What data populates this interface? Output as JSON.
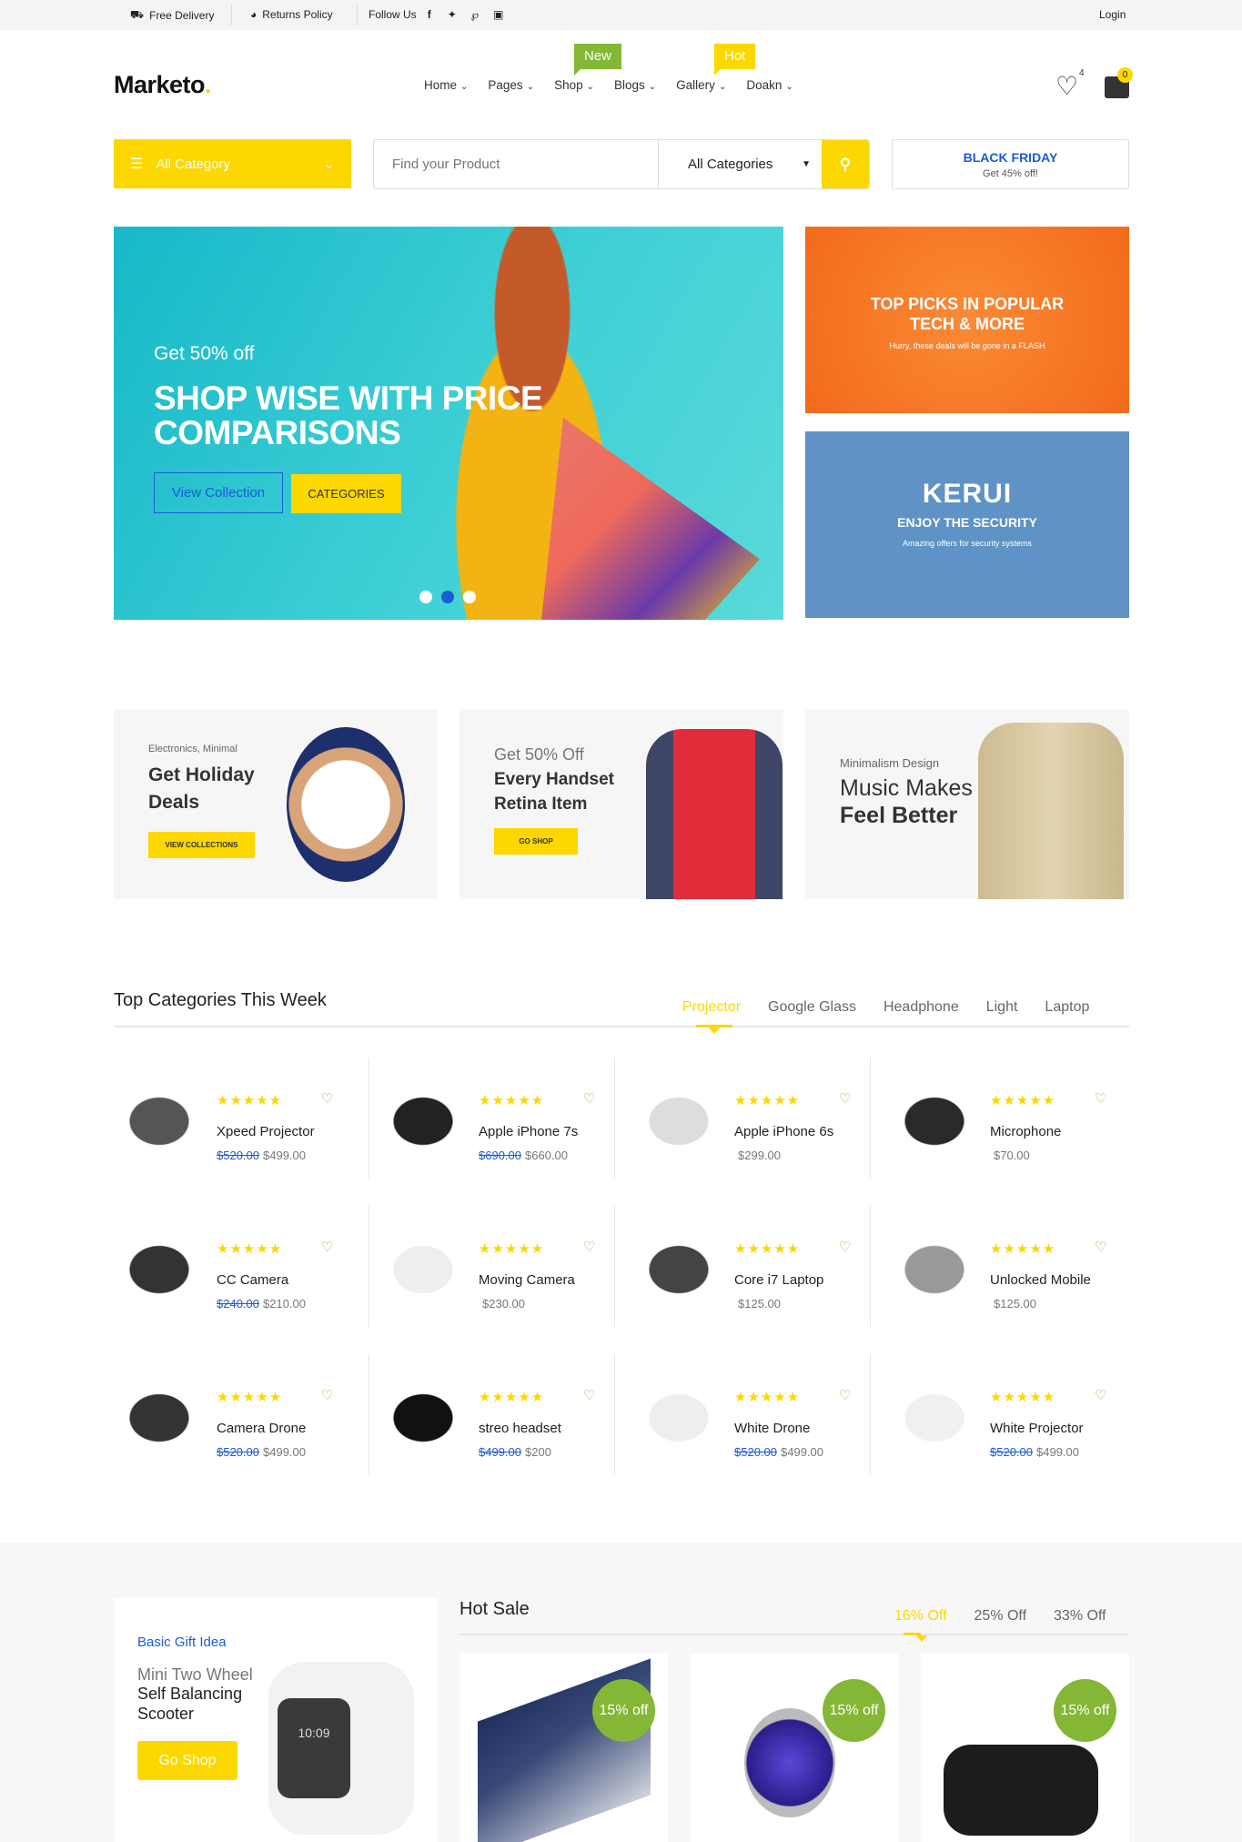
{
  "topbar": {
    "free_delivery": "Free Delivery",
    "returns_policy": "Returns Policy",
    "follow_us": "Follow Us",
    "social_icons": [
      "facebook-icon",
      "twitter-icon",
      "pinterest-icon",
      "instagram-icon"
    ],
    "login": "Login"
  },
  "header": {
    "logo": "Marketo",
    "logo_dot": ".",
    "nav": [
      "Home",
      "Pages",
      "Shop",
      "Blogs",
      "Gallery",
      "Doakn"
    ],
    "badge_new": "New",
    "badge_hot": "Hot",
    "wishlist_count": "4",
    "cart_count": "0"
  },
  "searchbar": {
    "category_button": "All Category",
    "placeholder": "Find your Product",
    "select_value": "All Categories",
    "promo_title": "BLACK FRIDAY",
    "promo_sub": "Get 45% off!"
  },
  "hero": {
    "subtitle": "Get 50% off",
    "title": "SHOP WISE WITH PRICE COMPARISONS",
    "btn_primary": "View Collection",
    "btn_secondary": "CATEGORIES",
    "slides": 3,
    "active_slide": 2
  },
  "side_banners": {
    "top": {
      "title": "TOP PICKS IN POPULAR TECH & MORE",
      "subtitle": "Hurry, these deals will be gone in a FLASH"
    },
    "bottom": {
      "brand": "KERUI",
      "title": "ENJOY THE SECURITY",
      "subtitle": "Amazing offers for security systems"
    }
  },
  "promos": [
    {
      "small": "Electronics, Minimal",
      "title": "Get Holiday Deals",
      "button": "VIEW COLLECTIONS"
    },
    {
      "small": "Get 50% Off",
      "title": "Every Handset Retina Item",
      "button": "GO SHOP"
    },
    {
      "small": "Minimalism Design",
      "title_light": "Music Makes",
      "title": "Feel Better"
    }
  ],
  "top_categories": {
    "title": "Top Categories This Week",
    "tabs": [
      "Projector",
      "Google Glass",
      "Headphone",
      "Light",
      "Laptop"
    ],
    "active_tab": "Projector",
    "rating": 5,
    "products": [
      {
        "name": "Xpeed Projector",
        "old_price": "$520.00",
        "price": "$499.00"
      },
      {
        "name": "Apple iPhone 7s",
        "old_price": "$690.00",
        "price": "$660.00"
      },
      {
        "name": "Apple iPhone 6s",
        "old_price": "",
        "price": "$299.00"
      },
      {
        "name": "Microphone",
        "old_price": "",
        "price": "$70.00"
      },
      {
        "name": "CC Camera",
        "old_price": "$240.00",
        "price": "$210.00"
      },
      {
        "name": "Moving Camera",
        "old_price": "",
        "price": "$230.00"
      },
      {
        "name": "Core i7 Laptop",
        "old_price": "",
        "price": "$125.00"
      },
      {
        "name": "Unlocked Mobile",
        "old_price": "",
        "price": "$125.00"
      },
      {
        "name": "Camera Drone",
        "old_price": "$520.00",
        "price": "$499.00"
      },
      {
        "name": "streo headset",
        "old_price": "$499.00",
        "price": "$200"
      },
      {
        "name": "White Drone",
        "old_price": "$520.00",
        "price": "$499.00"
      },
      {
        "name": "White Projector",
        "old_price": "$520.00",
        "price": "$499.00"
      }
    ]
  },
  "gift": {
    "label": "Basic Gift Idea",
    "line1": "Mini Two Wheel",
    "line2": "Self Balancing",
    "line3": "Scooter",
    "button": "Go Shop",
    "watch_time": "10:09"
  },
  "hot_sale": {
    "title": "Hot Sale",
    "tabs": [
      "16% Off",
      "25% Off",
      "33% Off"
    ],
    "active_tab": "16% Off",
    "cards": [
      {
        "badge": "15% off"
      },
      {
        "badge": "15% off"
      },
      {
        "badge": "15% off"
      }
    ]
  },
  "colors": {
    "accent": "#fcd700",
    "green": "#83b735",
    "link": "#1b5bd6"
  }
}
